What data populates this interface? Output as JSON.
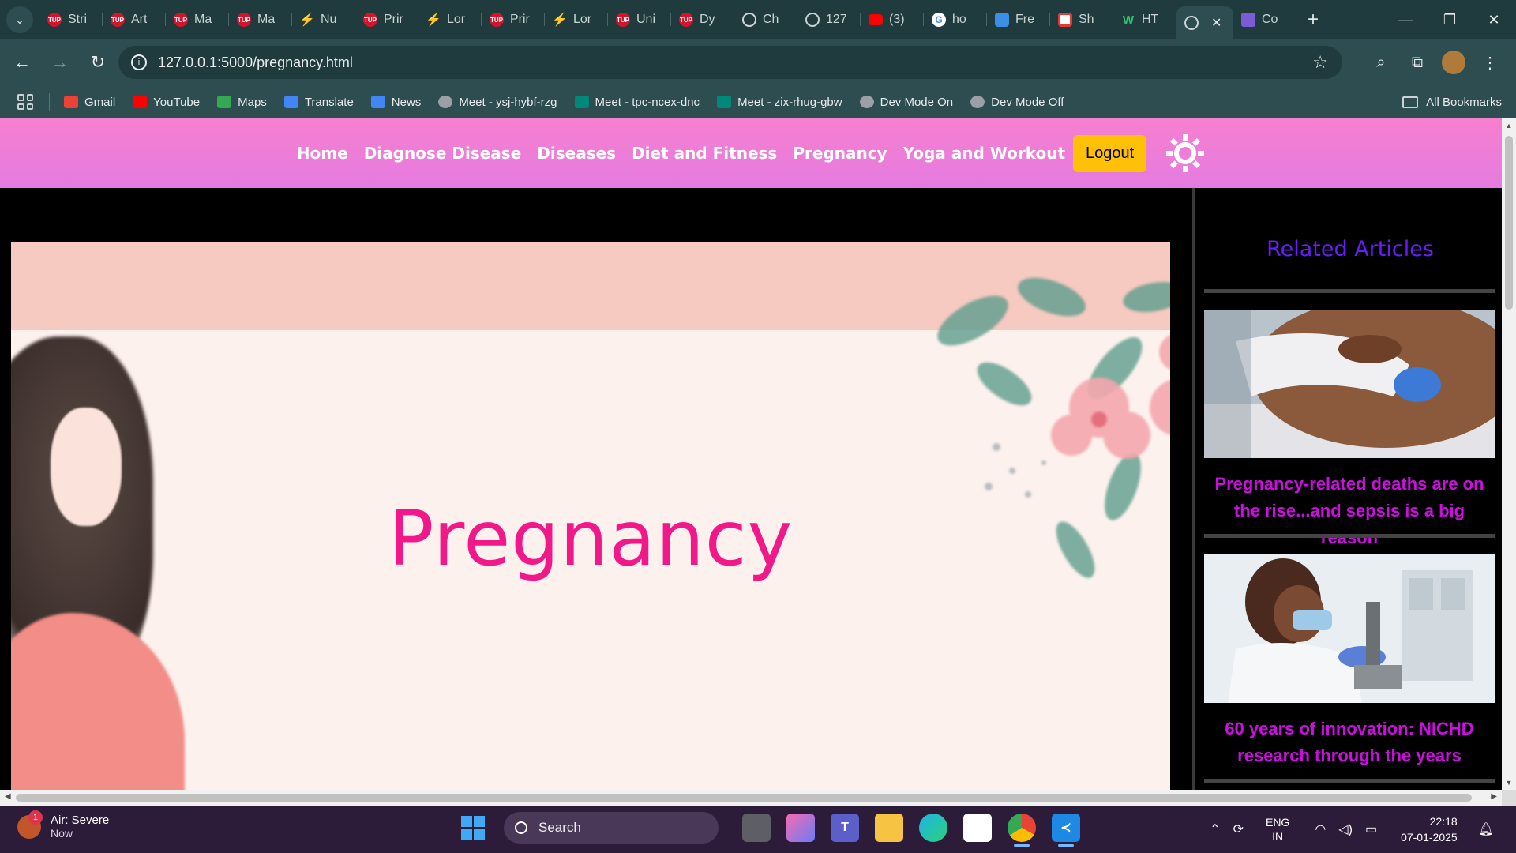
{
  "browser": {
    "tabs": [
      {
        "label": "Stri",
        "favicon": "tup-icon"
      },
      {
        "label": "Art",
        "favicon": "tup-icon"
      },
      {
        "label": "Ma",
        "favicon": "tup-icon"
      },
      {
        "label": "Ma",
        "favicon": "tup-icon"
      },
      {
        "label": "Nu",
        "favicon": "lightning-icon"
      },
      {
        "label": "Prir",
        "favicon": "tup-icon"
      },
      {
        "label": "Lor",
        "favicon": "lightning-icon"
      },
      {
        "label": "Prir",
        "favicon": "tup-icon"
      },
      {
        "label": "Lor",
        "favicon": "lightning-icon"
      },
      {
        "label": "Uni",
        "favicon": "tup-icon"
      },
      {
        "label": "Dy",
        "favicon": "tup-icon"
      },
      {
        "label": "Ch",
        "favicon": "chatgpt-icon"
      },
      {
        "label": "127",
        "favicon": "globe-icon"
      },
      {
        "label": "(3)",
        "favicon": "youtube-icon"
      },
      {
        "label": "ho",
        "favicon": "google-icon"
      },
      {
        "label": "Fre",
        "favicon": "app-icon"
      },
      {
        "label": "Sh",
        "favicon": "record-icon"
      },
      {
        "label": "HT",
        "favicon": "w-icon"
      }
    ],
    "active_tab_favicon": "globe-icon",
    "after_tab": {
      "label": "Co",
      "favicon": "doc-icon"
    },
    "url": "127.0.0.1:5000/pregnancy.html",
    "bookmarks": [
      {
        "label": "Gmail",
        "icon": "gmail-icon",
        "color": "#ea4335"
      },
      {
        "label": "YouTube",
        "icon": "youtube-icon",
        "color": "#ff0000"
      },
      {
        "label": "Maps",
        "icon": "maps-icon",
        "color": "#34a853"
      },
      {
        "label": "Translate",
        "icon": "translate-icon",
        "color": "#4285f4"
      },
      {
        "label": "News",
        "icon": "news-icon",
        "color": "#4285f4"
      },
      {
        "label": "Meet - ysj-hybf-rzg",
        "icon": "globe-icon",
        "color": "#9aa0a6"
      },
      {
        "label": "Meet - tpc-ncex-dnc",
        "icon": "meet-icon",
        "color": "#00897b"
      },
      {
        "label": "Meet - zix-rhug-gbw",
        "icon": "meet-icon",
        "color": "#00897b"
      },
      {
        "label": "Dev Mode On",
        "icon": "globe-icon",
        "color": "#9aa0a6"
      },
      {
        "label": "Dev Mode Off",
        "icon": "globe-icon",
        "color": "#9aa0a6"
      }
    ],
    "all_bookmarks": "All Bookmarks"
  },
  "site": {
    "nav": [
      "Home",
      "Diagnose Disease",
      "Diseases",
      "Diet and Fitness",
      "Pregnancy",
      "Yoga and Workout"
    ],
    "logout": "Logout",
    "hero_title": "Pregnancy",
    "aside_title": "Related Articles",
    "articles": [
      {
        "title": "Pregnancy-related deaths are on the rise...and sepsis is a big reason"
      },
      {
        "title": "60 years of innovation: NICHD research through the years"
      }
    ],
    "colors": {
      "nav_gradient_top": "#f77fcf",
      "nav_gradient_bottom": "#e47be0",
      "hero_title": "#f1188a",
      "aside_title": "#6a1bff",
      "article_title": "#cc0fe0",
      "logout_bg": "#ffc107"
    }
  },
  "taskbar": {
    "weather_title": "Air: Severe",
    "weather_sub": "Now",
    "weather_badge": "1",
    "search": "Search",
    "lang1": "ENG",
    "lang2": "IN",
    "time": "22:18",
    "date": "07-01-2025"
  }
}
